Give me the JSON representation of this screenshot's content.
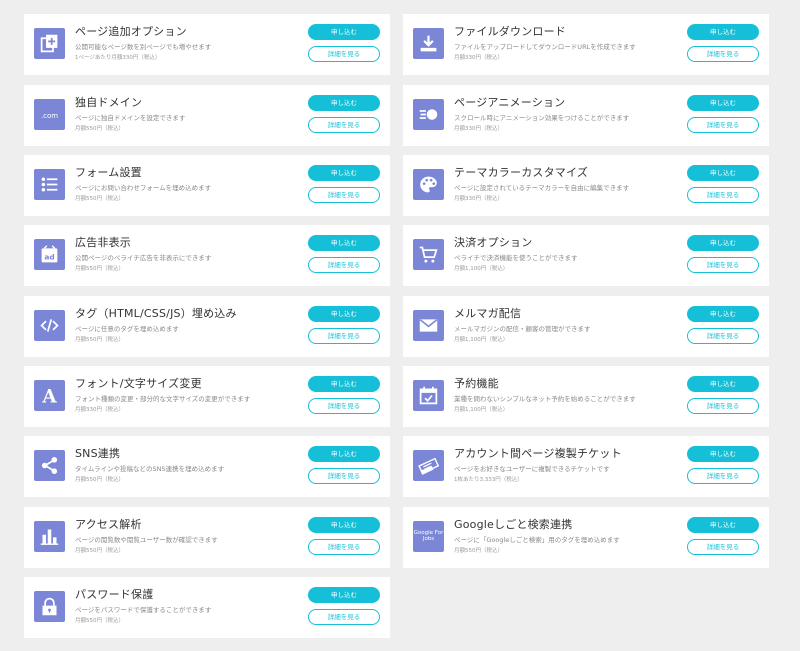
{
  "buttons": {
    "apply_label": "申し込む",
    "detail_label": "詳細を見る"
  },
  "colors": {
    "accent": "#15bfd7",
    "icon_bg": "#7b86d6",
    "page_bg": "#eeeeee"
  },
  "options": [
    {
      "title": "ページ追加オプション",
      "desc": "公開可能なページ数を別ページでも増やせます",
      "price": "1ページあたり月額330円（税込）",
      "icon": "add-page-icon"
    },
    {
      "title": "ファイルダウンロード",
      "desc": "ファイルをアップロードしてダウンロードURLを作成できます",
      "price": "月額330円（税込）",
      "icon": "download-icon"
    },
    {
      "title": "独自ドメイン",
      "desc": "ページに独自ドメインを設定できます",
      "price": "月額550円（税込）",
      "icon": "domain-icon",
      "icon_text": ".com"
    },
    {
      "title": "ページアニメーション",
      "desc": "スクロール時にアニメーション効果をつけることができます",
      "price": "月額330円（税込）",
      "icon": "animation-icon"
    },
    {
      "title": "フォーム設置",
      "desc": "ページにお問い合わせフォームを埋め込めます",
      "price": "月額550円（税込）",
      "icon": "form-list-icon"
    },
    {
      "title": "テーマカラーカスタマイズ",
      "desc": "ページに設定されているテーマカラーを自由に編集できます",
      "price": "月額330円（税込）",
      "icon": "palette-icon"
    },
    {
      "title": "広告非表示",
      "desc": "公開ページのペライチ広告を非表示にできます",
      "price": "月額550円（税込）",
      "icon": "ad-block-icon",
      "icon_text": "ad"
    },
    {
      "title": "決済オプション",
      "desc": "ペライチで決済機能を使うことができます",
      "price": "月額1,100円（税込）",
      "icon": "cart-icon"
    },
    {
      "title": "タグ（HTML/CSS/JS）埋め込み",
      "desc": "ページに任意のタグを埋め込めます",
      "price": "月額550円（税込）",
      "icon": "code-tag-icon"
    },
    {
      "title": "メルマガ配信",
      "desc": "メールマガジンの配信・顧客の管理ができます",
      "price": "月額1,100円（税込）",
      "icon": "mail-icon"
    },
    {
      "title": "フォント/文字サイズ変更",
      "desc": "フォント種類の変更・部分的な文字サイズの変更ができます",
      "price": "月額330円（税込）",
      "icon": "font-icon",
      "icon_text": "A"
    },
    {
      "title": "予約機能",
      "desc": "業種を問わないシンプルなネット予約を始めることができます",
      "price": "月額1,100円（税込）",
      "icon": "calendar-check-icon"
    },
    {
      "title": "SNS連携",
      "desc": "タイムラインや投稿などのSNS連携を埋め込めます",
      "price": "月額550円（税込）",
      "icon": "share-icon"
    },
    {
      "title": "アカウント間ページ複製チケット",
      "desc": "ページをお好きなユーザーに複製できるチケットです",
      "price": "1枚あたり3,333円（税込）",
      "icon": "ticket-icon"
    },
    {
      "title": "アクセス解析",
      "desc": "ページの閲覧数や閲覧ユーザー数が確認できます",
      "price": "月額550円（税込）",
      "icon": "bar-chart-icon"
    },
    {
      "title": "Googleしごと検索連携",
      "desc": "ページに「Googleしごと検索」用のタグを埋め込めます",
      "price": "月額550円（税込）",
      "icon": "google-for-jobs-icon",
      "icon_text": "Google For Jobs"
    },
    {
      "title": "パスワード保護",
      "desc": "ページをパスワードで保護することができます",
      "price": "月額550円（税込）",
      "icon": "lock-icon"
    }
  ]
}
